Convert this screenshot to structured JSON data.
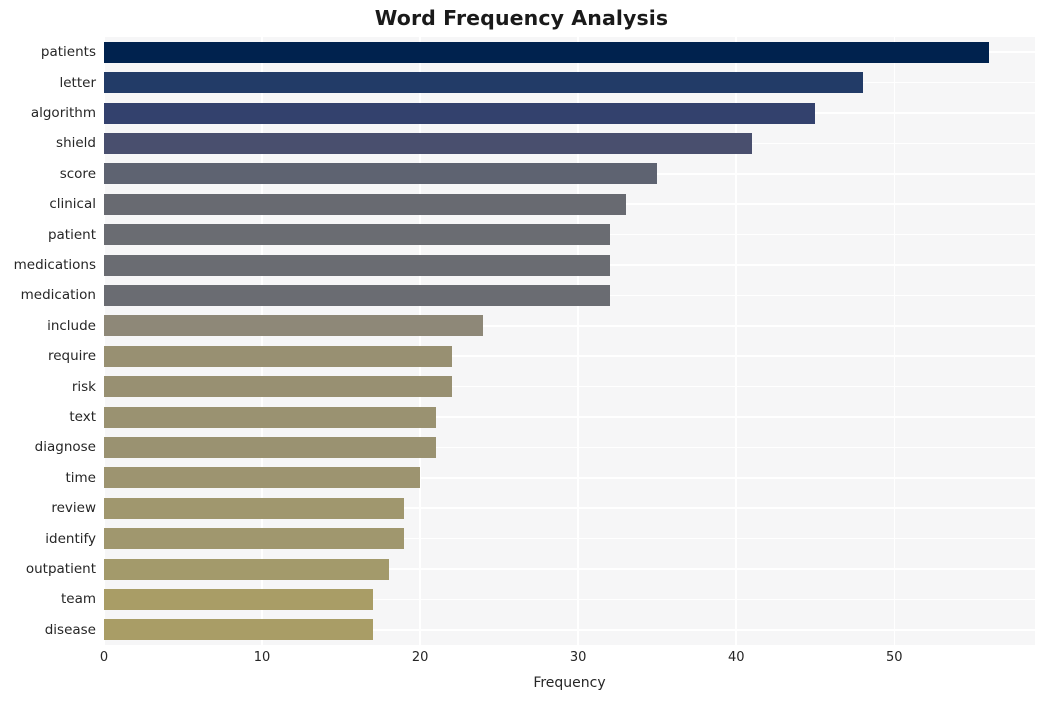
{
  "chart_data": {
    "type": "bar",
    "orientation": "horizontal",
    "title": "Word Frequency Analysis",
    "xlabel": "Frequency",
    "ylabel": "",
    "xlim": [
      0,
      58.9
    ],
    "xticks": [
      0,
      10,
      20,
      30,
      40,
      50
    ],
    "xtick_labels": [
      "0",
      "10",
      "20",
      "30",
      "40",
      "50"
    ],
    "grid": true,
    "grid_color": "#ffffff",
    "plot_background": "#f6f6f7",
    "legend": null,
    "colormap": "cividis",
    "categories": [
      "patients",
      "letter",
      "algorithm",
      "shield",
      "score",
      "clinical",
      "patient",
      "medications",
      "medication",
      "include",
      "require",
      "risk",
      "text",
      "diagnose",
      "time",
      "review",
      "identify",
      "outpatient",
      "team",
      "disease"
    ],
    "values": [
      56,
      48,
      45,
      41,
      35,
      33,
      32,
      32,
      32,
      24,
      22,
      22,
      21,
      21,
      20,
      19,
      19,
      18,
      17,
      17
    ],
    "bar_colors": [
      "#00224e",
      "#223b67",
      "#33416d",
      "#494f6e",
      "#5e6371",
      "#686a71",
      "#6a6c72",
      "#6a6c72",
      "#6a6c72",
      "#8e8878",
      "#989072",
      "#989072",
      "#9a9271",
      "#9a9271",
      "#9d9470",
      "#a0976e",
      "#a0976e",
      "#a39a6b",
      "#a99d66",
      "#a99d66"
    ]
  }
}
